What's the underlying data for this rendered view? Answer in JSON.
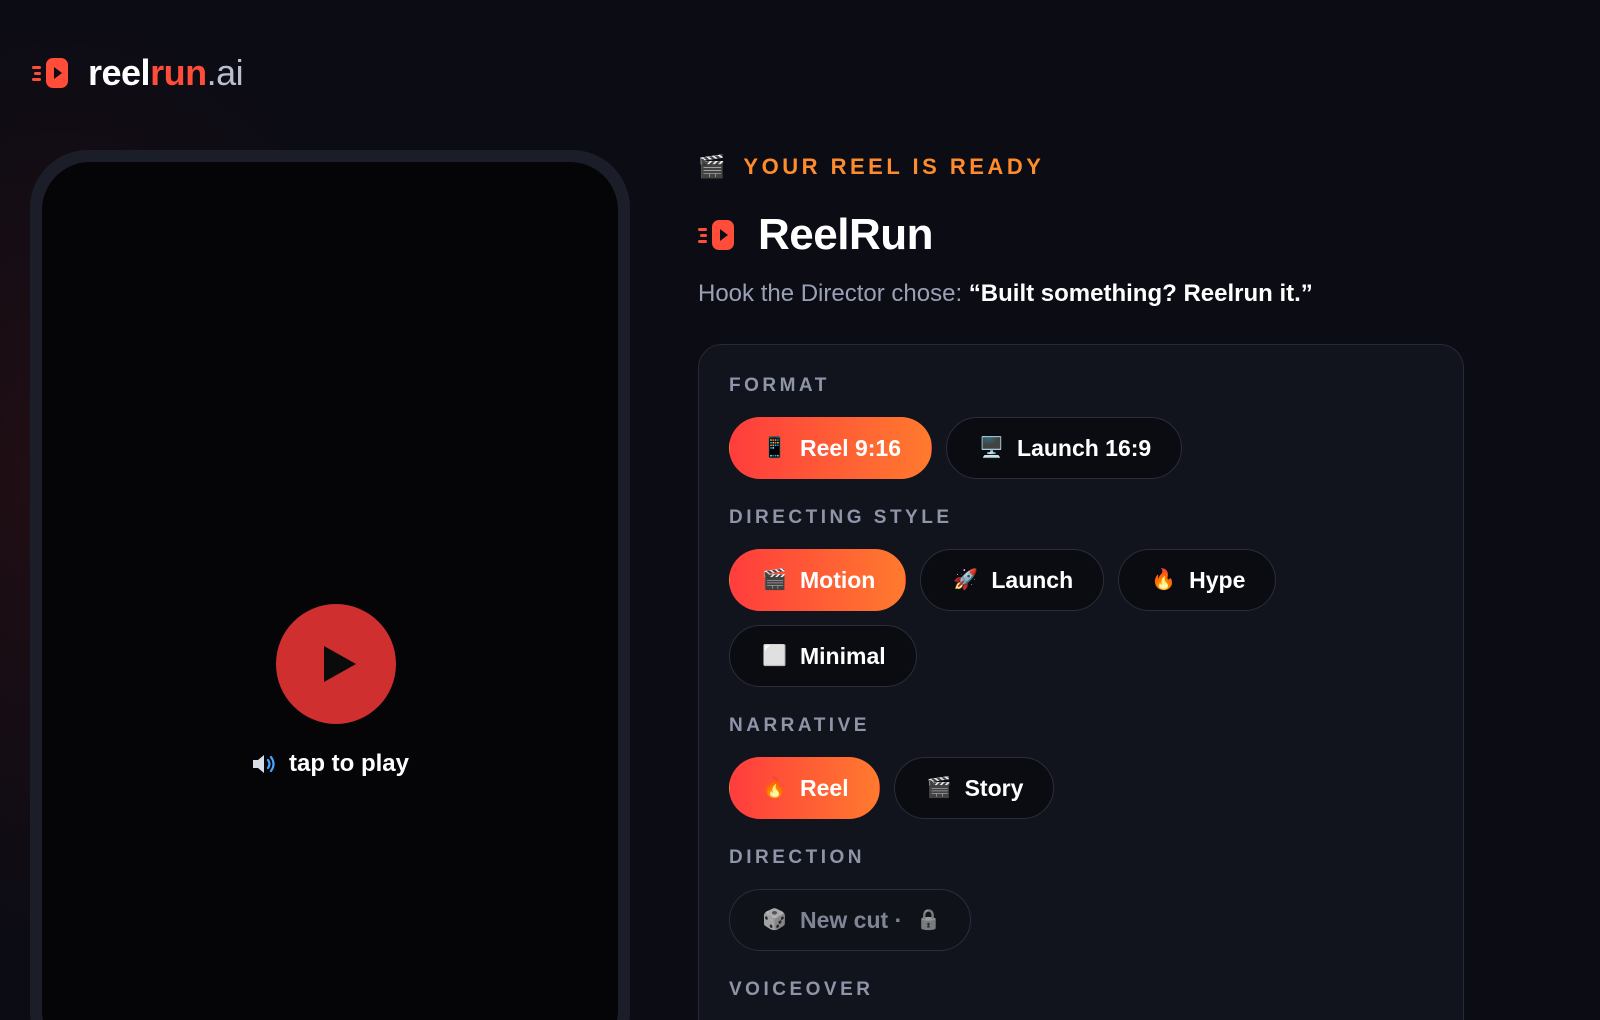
{
  "brand": {
    "part1": "reel",
    "part2": "run",
    "part3": ".ai"
  },
  "player": {
    "tap_label": "tap to play"
  },
  "result": {
    "eyebrow": "YOUR REEL IS READY",
    "eyebrow_icon": "🎬",
    "title": "ReelRun",
    "hook_prefix": "Hook the Director chose: ",
    "hook_text": "“Built something? Reelrun it.”"
  },
  "sections": {
    "format": {
      "label": "FORMAT",
      "options": [
        {
          "icon": "📱",
          "label": "Reel 9:16",
          "active": true
        },
        {
          "icon": "🖥️",
          "label": "Launch 16:9",
          "active": false
        }
      ]
    },
    "style": {
      "label": "DIRECTING STYLE",
      "options": [
        {
          "icon": "🎬",
          "label": "Motion",
          "active": true
        },
        {
          "icon": "🚀",
          "label": "Launch",
          "active": false
        },
        {
          "icon": "🔥",
          "label": "Hype",
          "active": false
        },
        {
          "icon": "⬜",
          "label": "Minimal",
          "active": false
        }
      ]
    },
    "narrative": {
      "label": "NARRATIVE",
      "options": [
        {
          "icon": "🔥",
          "label": "Reel",
          "active": true
        },
        {
          "icon": "🎬",
          "label": "Story",
          "active": false
        }
      ]
    },
    "direction": {
      "label": "DIRECTION",
      "options": [
        {
          "icon": "🎲",
          "label": "New cut ·",
          "lock_icon": "🔒",
          "active": false
        }
      ]
    },
    "voiceover": {
      "label": "VOICEOVER"
    }
  },
  "colors": {
    "accent_start": "#ff3d3d",
    "accent_end": "#ff7a2e",
    "eyebrow": "#ff8b2d",
    "play_button": "#cf2f2f"
  }
}
